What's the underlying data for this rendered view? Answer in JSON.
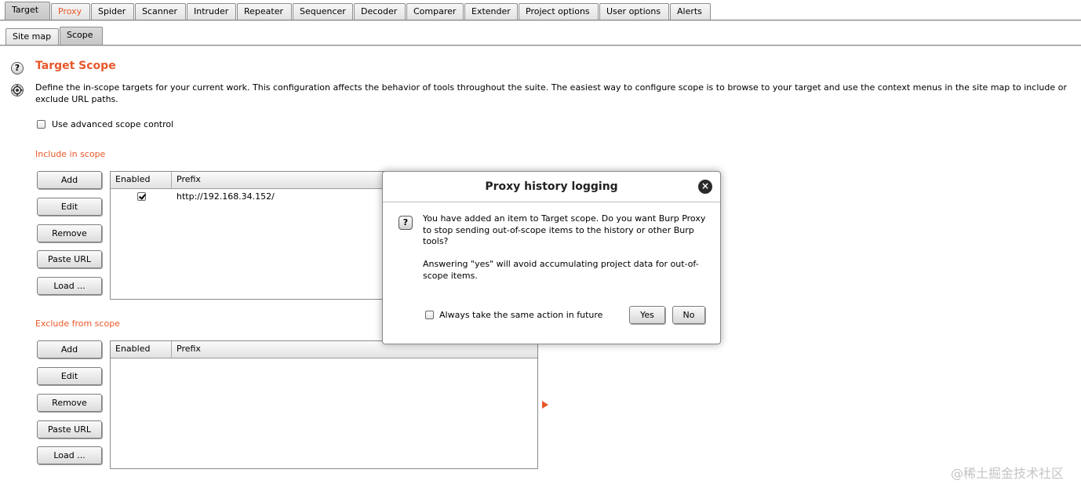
{
  "main_tabs": [
    {
      "label": "Target",
      "selected": true
    },
    {
      "label": "Proxy",
      "highlight_color": "#e8582a"
    },
    {
      "label": "Spider"
    },
    {
      "label": "Scanner"
    },
    {
      "label": "Intruder"
    },
    {
      "label": "Repeater"
    },
    {
      "label": "Sequencer"
    },
    {
      "label": "Decoder"
    },
    {
      "label": "Comparer"
    },
    {
      "label": "Extender"
    },
    {
      "label": "Project options"
    },
    {
      "label": "User options"
    },
    {
      "label": "Alerts"
    }
  ],
  "sub_tabs": [
    {
      "label": "Site map"
    },
    {
      "label": "Scope",
      "selected": true
    }
  ],
  "scope": {
    "title": "Target Scope",
    "description": "Define the in-scope targets for your current work. This configuration affects the behavior of tools throughout the suite. The easiest way to configure scope is to browse to your target and use the context menus in the site map to include or exclude URL paths.",
    "advanced_label": "Use advanced scope control",
    "advanced_checked": false,
    "help_icon": "question-icon",
    "settings_icon": "gear-icon"
  },
  "include": {
    "label": "Include in scope",
    "buttons": {
      "add": "Add",
      "edit": "Edit",
      "remove": "Remove",
      "paste": "Paste URL",
      "load": "Load ..."
    },
    "columns": {
      "enabled": "Enabled",
      "prefix": "Prefix"
    },
    "rows": [
      {
        "enabled": true,
        "prefix": "http://192.168.34.152/"
      }
    ]
  },
  "exclude": {
    "label": "Exclude from scope",
    "buttons": {
      "add": "Add",
      "edit": "Edit",
      "remove": "Remove",
      "paste": "Paste URL",
      "load": "Load ..."
    },
    "columns": {
      "enabled": "Enabled",
      "prefix": "Prefix"
    },
    "rows": []
  },
  "dialog": {
    "title": "Proxy history logging",
    "message1": "You have added an item to Target scope. Do you want Burp Proxy to stop sending out-of-scope items to the history or other Burp tools?",
    "message2": "Answering \"yes\" will avoid accumulating project data for out-of-scope items.",
    "checkbox_label": "Always take the same action in future",
    "checkbox_checked": false,
    "yes": "Yes",
    "no": "No",
    "close_icon": "close-icon"
  },
  "colors": {
    "accent": "#e8582a",
    "tab_bg": "#e4e4e4"
  },
  "watermark": "@稀土掘金技术社区"
}
